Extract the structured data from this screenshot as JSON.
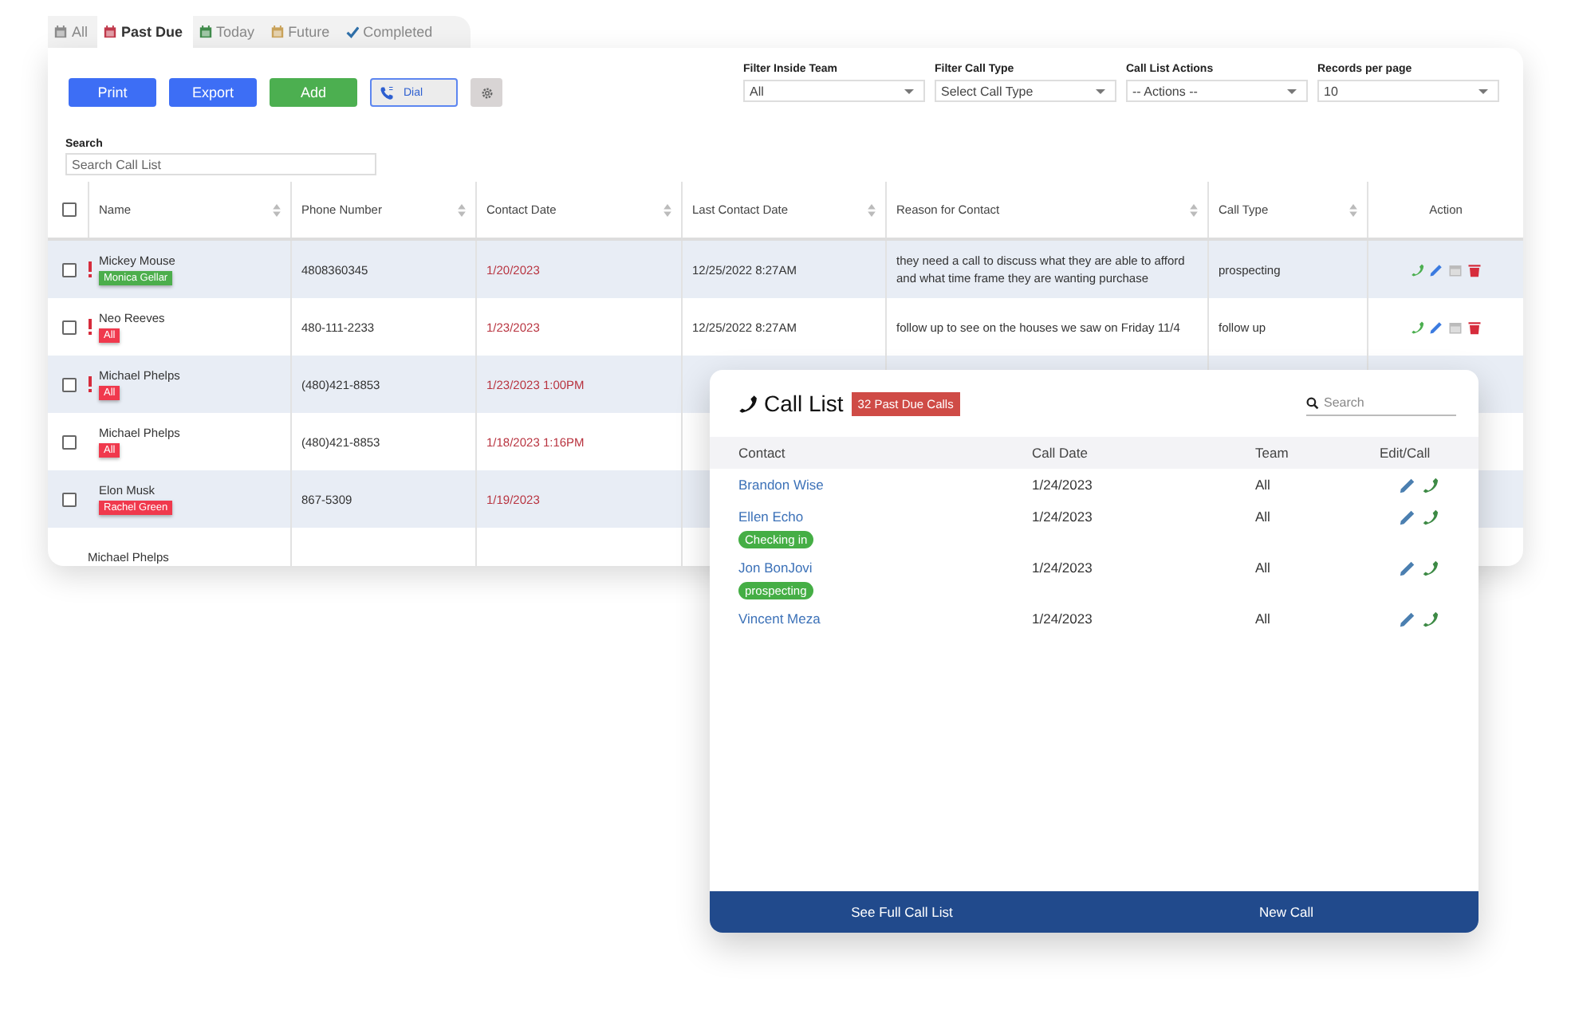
{
  "tabs": [
    {
      "label": "All",
      "kind": "calendar",
      "color": "#8a8a8a",
      "selected": false
    },
    {
      "label": "Past Due",
      "kind": "calendar",
      "color": "#c0394b",
      "selected": true
    },
    {
      "label": "Today",
      "kind": "calendar",
      "color": "#3f8a4a",
      "selected": false
    },
    {
      "label": "Future",
      "kind": "calendar",
      "color": "#c9a25a",
      "selected": false
    },
    {
      "label": "Completed",
      "kind": "check",
      "color": "#2f6fa8",
      "selected": false
    }
  ],
  "toolbar": {
    "buttons": [
      {
        "label": "Print",
        "kind": "blue"
      },
      {
        "label": "Export",
        "kind": "blue"
      },
      {
        "label": "Add",
        "kind": "green"
      },
      {
        "label": "Dial",
        "kind": "dial"
      }
    ],
    "filters": [
      {
        "label": "Filter Inside Team",
        "value": "All"
      },
      {
        "label": "Filter Call Type",
        "value": "Select Call Type"
      },
      {
        "label": "Call List Actions",
        "value": "-- Actions --"
      },
      {
        "label": "Records per page",
        "value": "10"
      }
    ],
    "search": {
      "label": "Search",
      "placeholder": "Search Call List"
    }
  },
  "table": {
    "header_checked": false,
    "columns": [
      "Name",
      "Phone Number",
      "Contact Date",
      "Last Contact Date",
      "Reason for Contact",
      "Call Type",
      "Action"
    ],
    "rows": [
      {
        "checked": false,
        "flagged": true,
        "name": "Mickey Mouse",
        "tag": {
          "label": "Monica Gellar",
          "color": "#4cae4c"
        },
        "phone": "4808360345",
        "contact_date": "1/20/2023",
        "last_contact": "12/25/2022 8:27AM",
        "reason": "they need a call to discuss what they are able to afford and what time frame they are wanting purchase",
        "call_type": "prospecting"
      },
      {
        "checked": false,
        "flagged": true,
        "name": "Neo Reeves",
        "tag": {
          "label": "All",
          "color": "#f0394d"
        },
        "phone": "480-111-2233",
        "contact_date": "1/23/2023",
        "last_contact": "12/25/2022 8:27AM",
        "reason": "follow up to see on the houses we saw on Friday 11/4",
        "call_type": "follow up"
      },
      {
        "checked": false,
        "flagged": true,
        "name": "Michael Phelps",
        "tag": {
          "label": "All",
          "color": "#f0394d"
        },
        "phone": "(480)421-8853",
        "contact_date": "1/23/2023 1:00PM"
      },
      {
        "checked": false,
        "flagged": false,
        "name": "Michael Phelps",
        "tag": {
          "label": "All",
          "color": "#f0394d"
        },
        "phone": "(480)421-8853",
        "contact_date": "1/18/2023 1:16PM"
      },
      {
        "checked": false,
        "flagged": false,
        "name": "Elon Musk",
        "tag": {
          "label": "Rachel Green",
          "color": "#f0394d"
        },
        "phone": "867-5309",
        "contact_date": "1/19/2023"
      },
      {
        "name": "Michael Phelps"
      }
    ]
  },
  "call_list": {
    "title": "Call List",
    "badge": "32 Past Due Calls",
    "search": {
      "placeholder": "Search"
    },
    "columns": [
      "Contact",
      "Call Date",
      "Team",
      "Edit/Call"
    ],
    "rows": [
      {
        "contact": "Brandon Wise",
        "date": "1/24/2023",
        "team": "All"
      },
      {
        "contact": "Ellen Echo",
        "tag": "Checking in",
        "date": "1/24/2023",
        "team": "All"
      },
      {
        "contact": "Jon BonJovi",
        "tag": "prospecting",
        "date": "1/24/2023",
        "team": "All"
      },
      {
        "contact": "Vincent Meza",
        "date": "1/24/2023",
        "team": "All"
      }
    ],
    "footer": [
      "See Full Call List",
      "New Call"
    ]
  }
}
